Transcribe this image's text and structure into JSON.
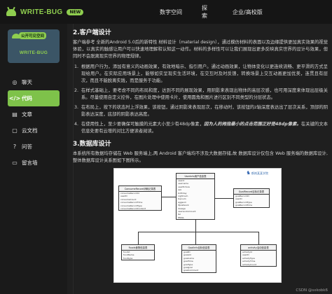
{
  "topbar": {
    "brand": "WRITE-BUG",
    "badge": "NEW",
    "nav": [
      "数字空间",
      "探索",
      "企业/高校版"
    ]
  },
  "sidebar": {
    "card_pill": "公开可见空间",
    "card_title": "WRITE-BUG",
    "items": [
      {
        "label": "聊天",
        "icon": "chat-icon",
        "glyph": "◎",
        "active": false
      },
      {
        "label": "代码",
        "icon": "code-icon",
        "glyph": "</>",
        "active": true
      },
      {
        "label": "文章",
        "icon": "article-icon",
        "glyph": "▤",
        "active": false
      },
      {
        "label": "云文档",
        "icon": "cloud-doc-icon",
        "glyph": "▢",
        "active": false
      },
      {
        "label": "问答",
        "icon": "qa-icon",
        "glyph": "?",
        "active": false
      },
      {
        "label": "留言墙",
        "icon": "message-wall-icon",
        "glyph": "▭",
        "active": false
      }
    ]
  },
  "content": {
    "section2_title": "2.客户端设计",
    "section2_intro": "客户端参考 全新的Android 5.0后的新特性 材料设计（material design），通过模仿材料的表面以及边缘提供更加真实效果的视觉体验，以真实的触感让用户可以快速地理解和认知这一动作。材料的多样性可以让我们展现出更多反映真实世界的设计与效果，但同时不会脱离现实世界的物理规律。",
    "items": [
      "根据用户行为，添加有意义的动画效果，有效地暗示、指引用户。通过动画效果，让物体变化以更连续流畅、更平滑的方式呈现给用户。在实际应用场景上，能够如实呈现实生活环境，在交互时及时反馈，转换场景上交互动画更加优美，连贯且有层次，而且不能脱离实践，而是服务于功能。",
      "在样式基础上，要考虑不同的布局和度，达到不同的展现效果，用阴影来表现出物体的高层次感，也可用深度来体现出层级关系。尽量使用自定义控件，在图片处理中使用卡片，使用圆角和图片进行区别不同类型的分层状态。",
      "在布局上，按下的状态时上浮效果，该按钮，通过阴影来表现层次，在移动时，该按钮的z轴深度表达出了层次关系，顶部的阴影表达深度，底部的阴影表达高度。",
      "在使用性上，至少要确保可触摸的元素大小至少有48dp像素，因为人的拇指最小的点击范围正好是48dp像素。在关键的文本信息处要有云增的对比方便读者阅读。"
    ],
    "item4_emphasis": "因为人的拇指最小的点击范围正好是48dp像素。",
    "section3_title": "3.数据库设计",
    "section3_intro": "本系统所有数据均存储在 Web 服务端上,两 Android 客户端均不涉及大数据存储,故 数据库设计仅包含 Web 服务端的数据库设计,整体数据库设计关系图如下图所示。"
  },
  "diagram": {
    "tables": [
      {
        "name": "UserInfo用户信息表",
        "rows": [
          "userid",
          "username",
          "userPicture",
          "sex",
          "birthday",
          "nightnum",
          "topnum",
          "eggsum",
          "ifpostwork",
          "dosage",
          "userworkAmount",
          "tel",
          "EMAIL"
        ]
      },
      {
        "name": "ConsumeRecord消耗记录表",
        "rows": [
          "consumeRecordId",
          "userID",
          "consumeCount",
          "consumeRecordTime",
          "consumeRecordType",
          "consumeRecordContent"
        ]
      },
      {
        "name": "GoalRecord目标记录表",
        "rows": [
          "goalRecordId",
          "userID",
          "goalRecordType",
          "goalRecordTime"
        ]
      },
      {
        "name": "Foods食物信息表",
        "rows": [
          "foodid",
          "foodName",
          "foodtype"
        ]
      },
      {
        "name": "GoalInfo目标信息表",
        "rows": [
          "goalID",
          "goalsId",
          "goalname",
          "goalTime",
          "goalType",
          "goalgoal",
          "goalComment"
        ]
      },
      {
        "name": "activity活动信息表",
        "rows": [
          "activityId",
          "userID",
          "activityType",
          "activityTime",
          "activityCount"
        ]
      }
    ],
    "watermark": "鹤岗某某学院"
  },
  "footer": {
    "credit": "CSDN @sxkobk6"
  }
}
